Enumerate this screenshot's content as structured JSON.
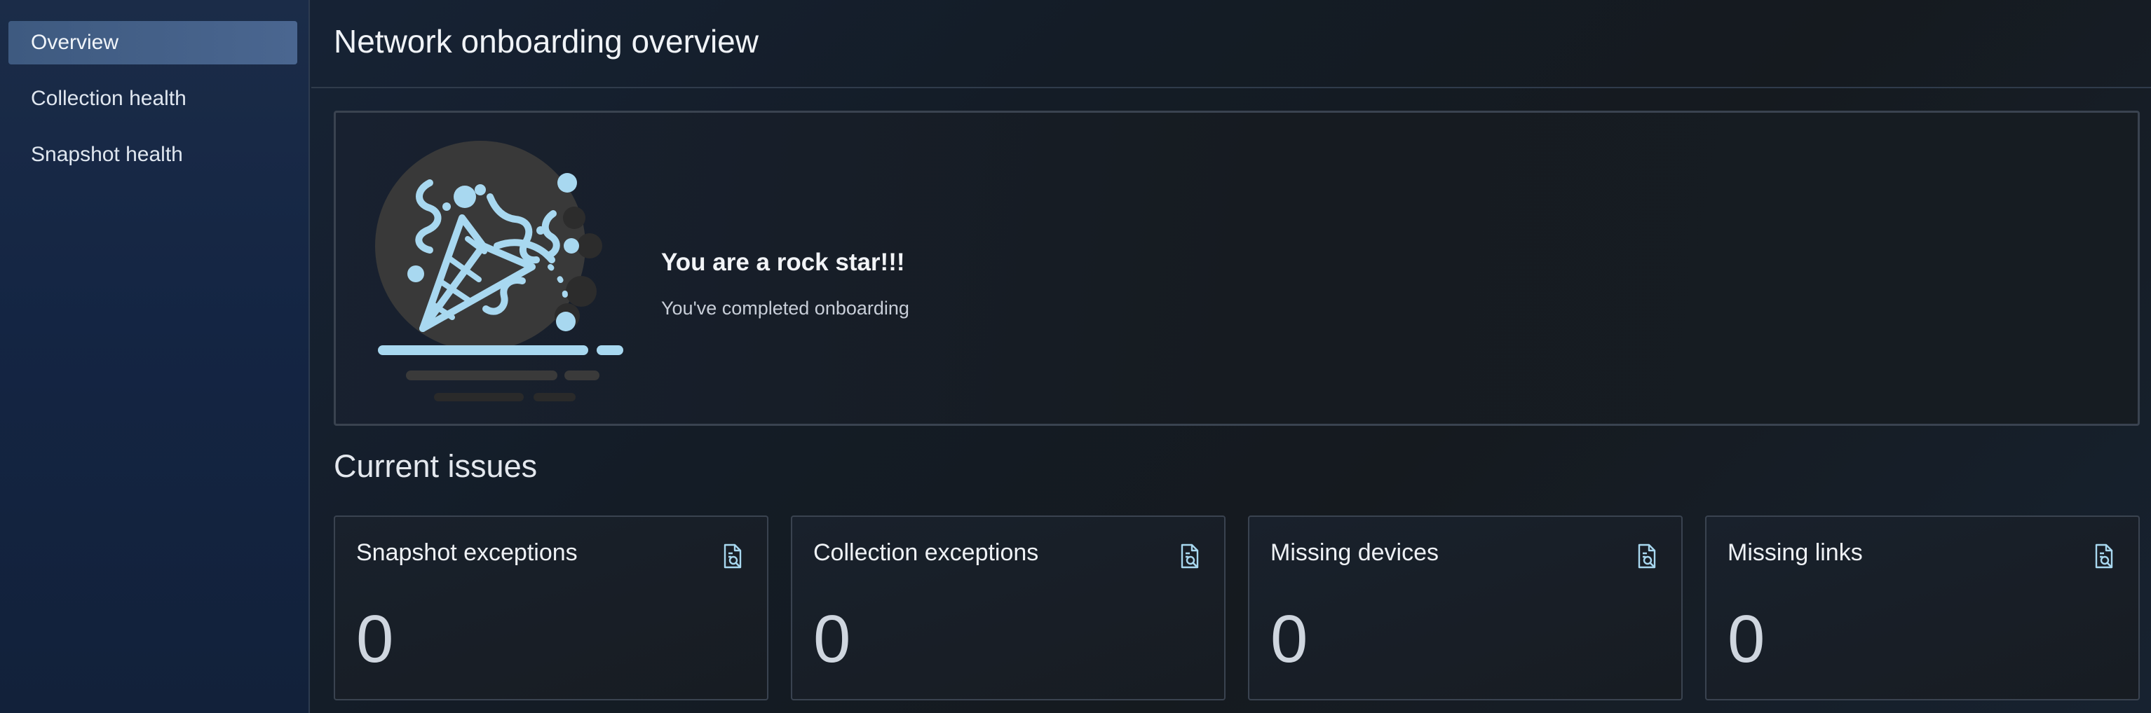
{
  "sidebar": {
    "items": [
      {
        "label": "Overview",
        "active": true
      },
      {
        "label": "Collection health",
        "active": false
      },
      {
        "label": "Snapshot health",
        "active": false
      }
    ]
  },
  "header": {
    "title": "Network onboarding overview"
  },
  "banner": {
    "illustration": "party-popper-icon",
    "title": "You are a rock star!!!",
    "subtitle": "You've completed onboarding"
  },
  "issues": {
    "section_title": "Current issues",
    "cards": [
      {
        "title": "Snapshot exceptions",
        "value": "0",
        "icon": "report-search-icon"
      },
      {
        "title": "Collection exceptions",
        "value": "0",
        "icon": "report-search-icon"
      },
      {
        "title": "Missing devices",
        "value": "0",
        "icon": "report-search-icon"
      },
      {
        "title": "Missing links",
        "value": "0",
        "icon": "report-search-icon"
      }
    ]
  },
  "colors": {
    "accent": "#a8d8f0",
    "active_nav": "#4a6690",
    "background": "#151b22"
  }
}
